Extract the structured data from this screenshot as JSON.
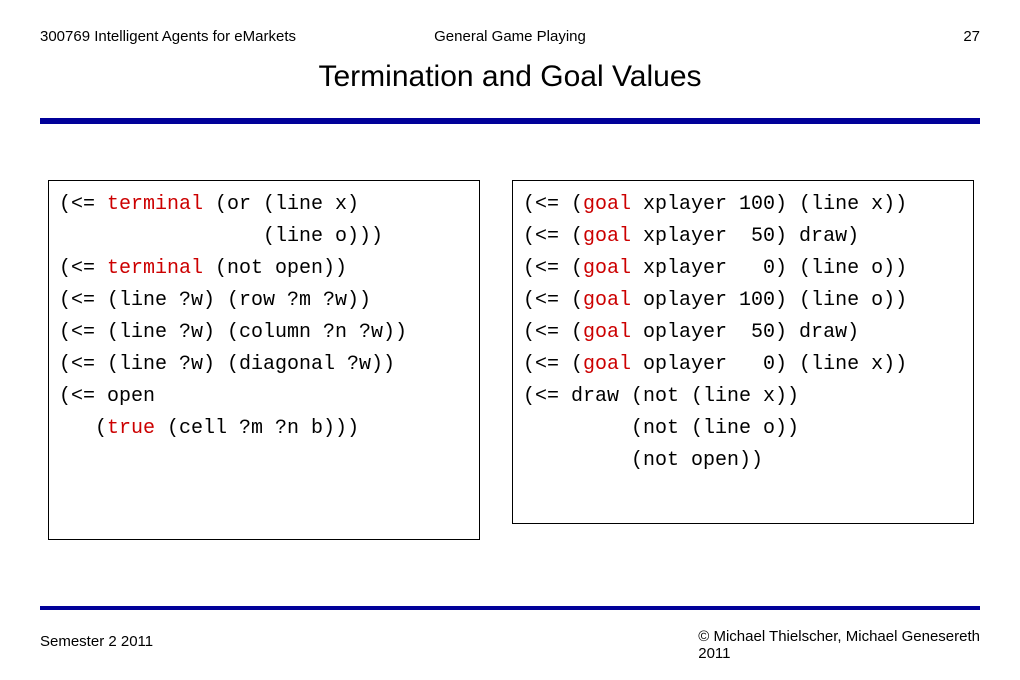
{
  "header": {
    "left": "300769 Intelligent Agents for eMarkets",
    "center": "General Game Playing",
    "page": "27"
  },
  "title": "Termination and Goal Values",
  "footer": {
    "left": "Semester 2 2011",
    "right_line1": "© Michael Thielscher, Michael Genesereth",
    "right_line2": "2011"
  },
  "code_left": {
    "l1a": "(<= ",
    "l1kw": "terminal",
    "l1b": " (or (line x)",
    "l2": "                 (line o)))",
    "l3a": "(<= ",
    "l3kw": "terminal",
    "l3b": " (not open))",
    "l4": "",
    "l5": "(<= (line ?w) (row ?m ?w))",
    "l6": "(<= (line ?w) (column ?n ?w))",
    "l7": "(<= (line ?w) (diagonal ?w))",
    "l8": "",
    "l9": "(<= open",
    "l10a": "   (",
    "l10kw": "true",
    "l10b": " (cell ?m ?n b)))"
  },
  "code_right": {
    "l1a": "(<= (",
    "l1kw": "goal",
    "l1b": " xplayer 100) (line x))",
    "l2a": "(<= (",
    "l2kw": "goal",
    "l2b": " xplayer  50) draw)",
    "l3a": "(<= (",
    "l3kw": "goal",
    "l3b": " xplayer   0) (line o))",
    "l4": "",
    "l5a": "(<= (",
    "l5kw": "goal",
    "l5b": " oplayer 100) (line o))",
    "l6a": "(<= (",
    "l6kw": "goal",
    "l6b": " oplayer  50) draw)",
    "l7a": "(<= (",
    "l7kw": "goal",
    "l7b": " oplayer   0) (line x))",
    "l8": "",
    "l9": "(<= draw (not (line x))",
    "l10": "         (not (line o))",
    "l11": "         (not open))"
  }
}
